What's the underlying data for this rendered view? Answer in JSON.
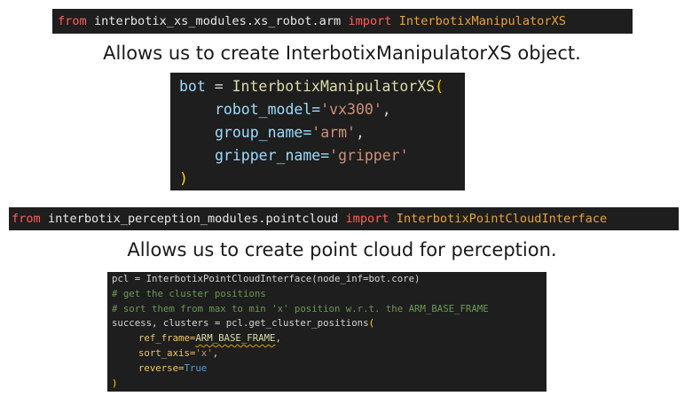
{
  "block1": {
    "import": {
      "kw_from": "from",
      "module": "interbotix_xs_modules.xs_robot.arm",
      "kw_import": "import",
      "class_name": "InterbotixManipulatorXS"
    },
    "caption": "Allows us to create InterbotixManipulatorXS object.",
    "code": {
      "var": "bot",
      "eq": " = ",
      "cls": "InterbotixManipulatorXS",
      "open": "(",
      "args": [
        {
          "name": "robot_model=",
          "value": "'vx300'",
          "sep": ","
        },
        {
          "name": "group_name=",
          "value": "'arm'",
          "sep": ","
        },
        {
          "name": "gripper_name=",
          "value": "'gripper'",
          "sep": ""
        }
      ],
      "close": ")"
    }
  },
  "block2": {
    "import": {
      "kw_from": "from",
      "module": "interbotix_perception_modules.pointcloud",
      "kw_import": "import",
      "class_name": "InterbotixPointCloudInterface"
    },
    "caption": "Allows us to create point cloud for perception.",
    "code": {
      "line1": "pcl = InterbotixPointCloudInterface(node_inf=bot.core)",
      "comment1": "# get the cluster positions",
      "comment2": "# sort them from max to min 'x' position w.r.t. the ARM_BASE_FRAME",
      "call_prefix": "success, clusters = pcl.get_cluster_positions",
      "open": "(",
      "arg1_name": "ref_frame=",
      "arg1_value": "ARM_BASE_FRAME",
      "arg1_sep": ",",
      "arg2_name": "sort_axis=",
      "arg2_value": "'x'",
      "arg2_sep": ",",
      "arg3_name": "reverse=",
      "arg3_value": "True",
      "close": ")"
    }
  },
  "colors": {
    "code_bg": "#1e1e1e",
    "keyword": "#ff5f56",
    "class": "#e8a33d",
    "string": "#ce9178",
    "comment": "#6a9955",
    "bracket": "#ffd700"
  }
}
